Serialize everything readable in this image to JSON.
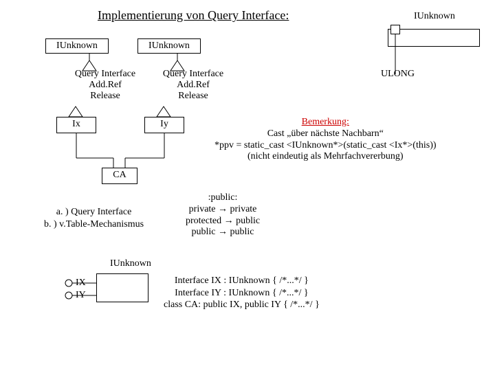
{
  "title": "Implementierung von Query Interface:",
  "top_right_label": "IUnknown",
  "left_box": "IUnknown",
  "mid_box": "IUnknown",
  "methods": {
    "line1": "Query Interface",
    "line2": "Add.Ref",
    "line3": "Release"
  },
  "ix_label": "Ix",
  "iy_label": "Iy",
  "ulong_label": "ULONG",
  "ca_label": "CA",
  "bemerkung": {
    "head": "Bemerkung:",
    "l1": "Cast „über nächste Nachbarn“",
    "l2": "*ppv = static_cast <IUnknown*>(static_cast <Ix*>(this))",
    "l3": "(nicht eindeutig als Mehrfachvererbung)"
  },
  "public_block": {
    "l1": ":public:",
    "l2": "private → private",
    "l3": "protected → public",
    "l4": "public → public"
  },
  "mechanism": {
    "l1": "a. ) Query Interface",
    "l2": "b. ) v.Table-Mechanismus"
  },
  "ix": "IX",
  "iy": "IY",
  "iunknown4": "IUnknown",
  "code": {
    "l1": "Interface IX : IUnknown { /*...*/ }",
    "l2": "Interface IY : IUnknown { /*...*/ }",
    "l3": "class CA: public IX, public IY { /*...*/ }"
  }
}
